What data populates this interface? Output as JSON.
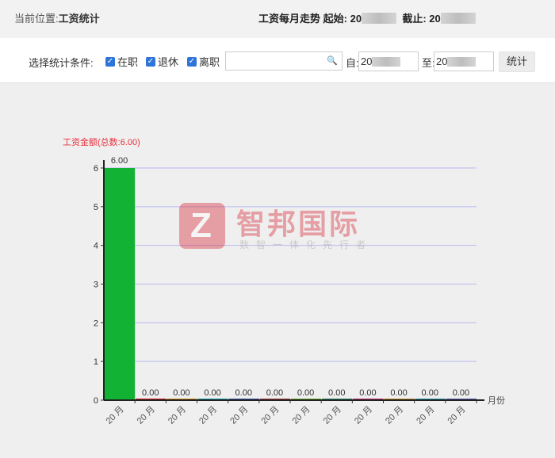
{
  "header": {
    "location_label": "当前位置:",
    "location_value": "工资统计",
    "trend_label": "工资每月走势",
    "start_label": "起始:",
    "start_value": "20",
    "end_label": "截止:",
    "end_value": "20"
  },
  "filters": {
    "condition_label": "选择统计条件:",
    "checkboxes": [
      {
        "label": "在职",
        "checked": true
      },
      {
        "label": "退休",
        "checked": true
      },
      {
        "label": "离职",
        "checked": true
      }
    ],
    "search_value": "",
    "from_label": "自:",
    "from_value": "20",
    "to_label": "至:",
    "to_value": "20",
    "submit_label": "统计"
  },
  "watermark": {
    "logo_letter": "Z",
    "name": "智邦国际",
    "slogan": "数智一体化先行者"
  },
  "chart_data": {
    "type": "bar",
    "title": "工资金额(总数:6.00)",
    "xlabel": "月份",
    "ylabel": "",
    "ylim": [
      0,
      6
    ],
    "yticks": [
      0,
      1,
      2,
      3,
      4,
      5,
      6
    ],
    "grid": true,
    "categories": [
      "20  月",
      "20  月",
      "20  月",
      "20  月",
      "20  月",
      "20  月",
      "20  月",
      "20  月",
      "20  月",
      "20  月",
      "20  月",
      "20  月"
    ],
    "values": [
      6.0,
      0.0,
      0.0,
      0.0,
      0.0,
      0.0,
      0.0,
      0.0,
      0.0,
      0.0,
      0.0,
      0.0
    ],
    "value_labels": [
      "6.00",
      "0.00",
      "0.00",
      "0.00",
      "0.00",
      "0.00",
      "0.00",
      "0.00",
      "0.00",
      "0.00",
      "0.00",
      "0.00"
    ],
    "bar_colors": [
      "#12b234",
      "#d81b1b",
      "#cc8a1a",
      "#1aa0b0",
      "#3a57a8",
      "#a83a3a",
      "#6aaa2a",
      "#2a8a6a",
      "#c0306a",
      "#c08a2a",
      "#2a9aaa",
      "#5a5aaa"
    ],
    "gridline_color": "#b9b9f0",
    "title_color": "#e8303c"
  }
}
